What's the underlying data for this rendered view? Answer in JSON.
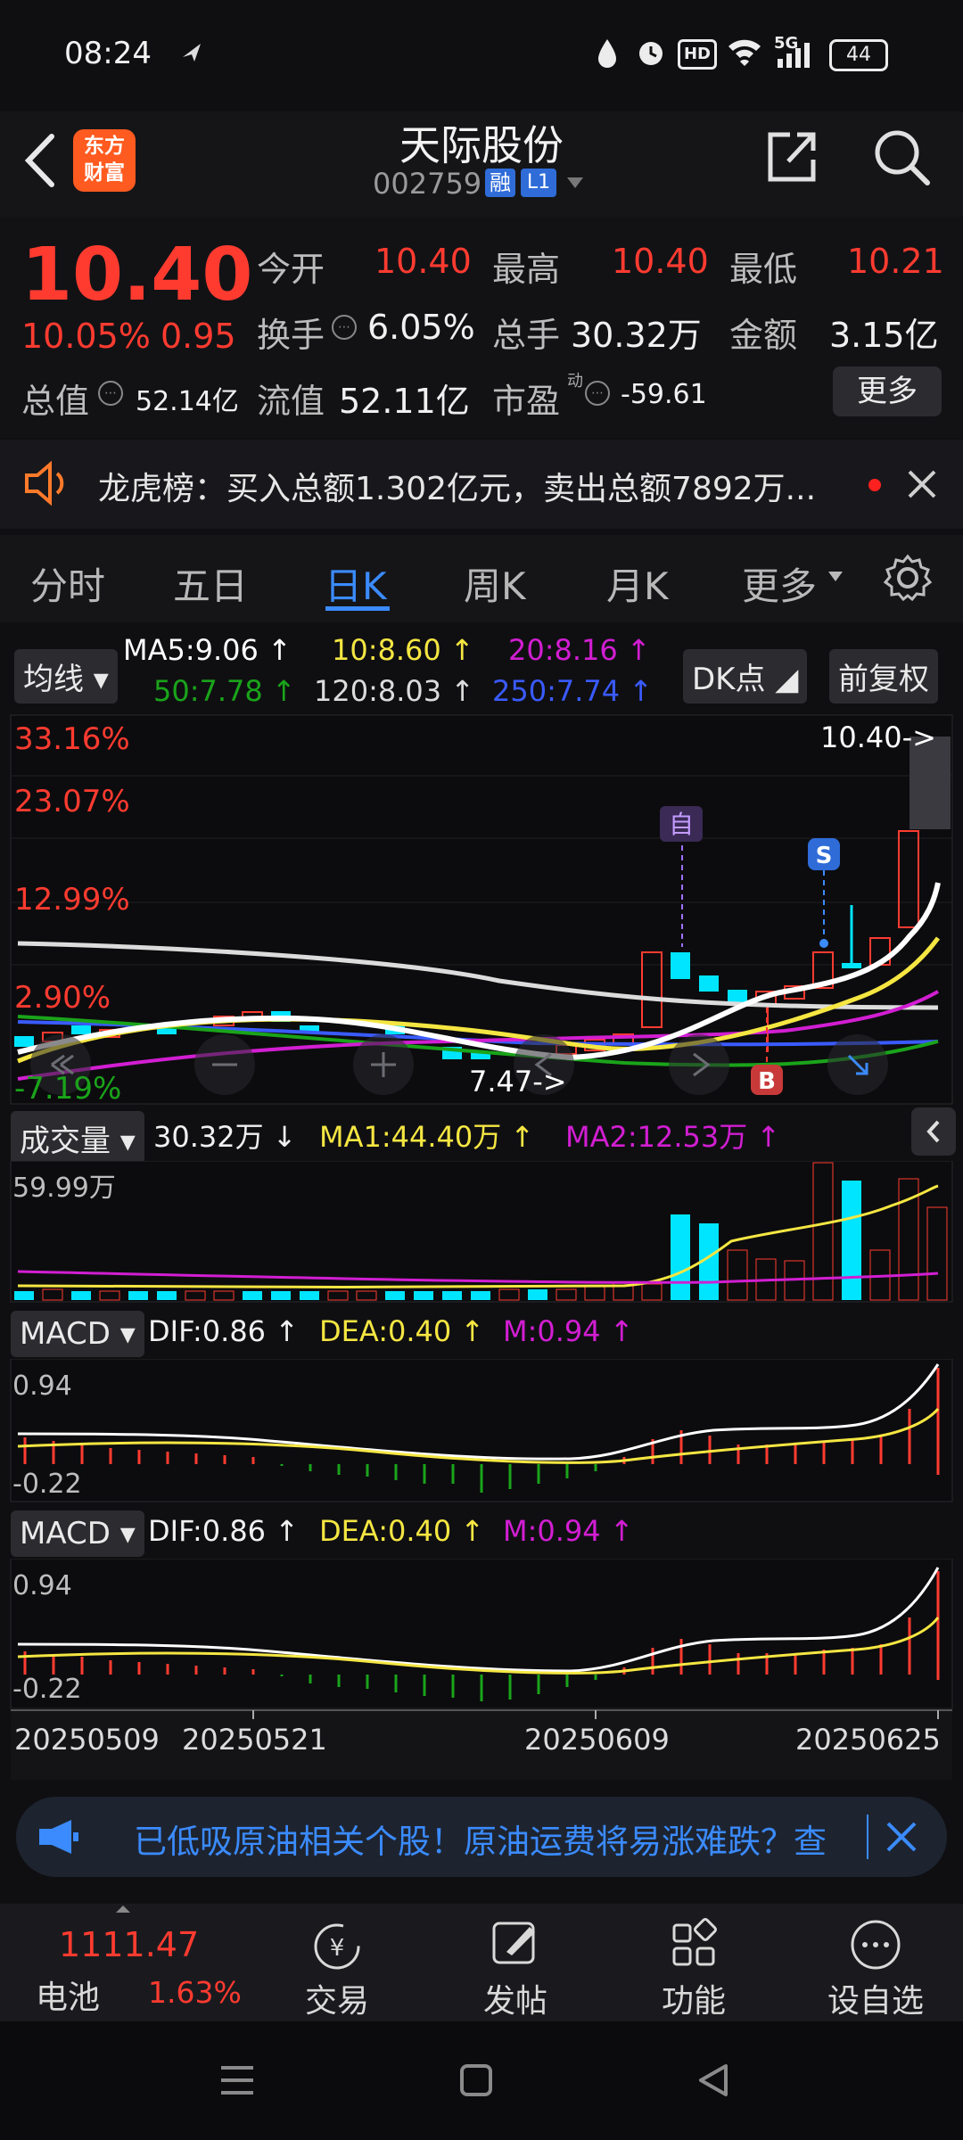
{
  "status": {
    "time": "08:24",
    "battery": "44",
    "network": "5G",
    "hd": "HD"
  },
  "header": {
    "title": "天际股份",
    "code": "002759",
    "badge_rong": "融",
    "badge_l1": "L1",
    "logo_line1": "东方",
    "logo_line2": "财富"
  },
  "quote": {
    "price": "10.40",
    "pct": "10.05%",
    "chg": "0.95",
    "fields": [
      {
        "label": "今开",
        "value": "10.40"
      },
      {
        "label": "最高",
        "value": "10.40"
      },
      {
        "label": "最低",
        "value": "10.21"
      },
      {
        "label": "换手",
        "value": "6.05%"
      },
      {
        "label": "总手",
        "value": "30.32万"
      },
      {
        "label": "金额",
        "value": "3.15亿"
      },
      {
        "label": "总值",
        "value": "52.14亿"
      },
      {
        "label": "流值",
        "value": "52.11亿"
      },
      {
        "label": "市盈",
        "value": "-59.61"
      }
    ],
    "pe_tag": "动",
    "more": "更多"
  },
  "lhb": {
    "text": "龙虎榜：买入总额1.302亿元，卖出总额7892万..."
  },
  "tabs": [
    {
      "label": "分时"
    },
    {
      "label": "五日"
    },
    {
      "label": "日K"
    },
    {
      "label": "周K"
    },
    {
      "label": "月K"
    },
    {
      "label": "更多"
    }
  ],
  "ma": {
    "selector": "均线",
    "ma5": "MA5:9.06 ↑",
    "ma10": "10:8.60 ↑",
    "ma20": "20:8.16 ↑",
    "ma50": "50:7.78 ↑",
    "ma120": "120:8.03 ↑",
    "ma250": "250:7.74 ↑",
    "dk": "DK点",
    "fq": "前复权"
  },
  "kline": {
    "pct_labels": [
      "33.16%",
      "23.07%",
      "12.99%",
      "2.90%",
      "-7.19%"
    ],
    "last_price": "10.40->",
    "low_marker": "7.47->",
    "marker_zi": "自",
    "marker_s": "S",
    "marker_b": "B",
    "colors": {
      "up": "#ff3b30",
      "down": "#00e5ff",
      "ma5": "#ffffff",
      "ma10": "#f5e642",
      "ma20": "#d21ed2",
      "ma50": "#1aa41a",
      "ma120": "#dcdcdc",
      "ma250": "#3a5bff"
    }
  },
  "volume": {
    "selector": "成交量",
    "value": "30.32万 ↓",
    "ma1": "MA1:44.40万 ↑",
    "ma2": "MA2:12.53万 ↑",
    "max": "59.99万"
  },
  "macd1": {
    "selector": "MACD",
    "dif": "DIF:0.86 ↑",
    "dea": "DEA:0.40 ↑",
    "m": "M:0.94 ↑",
    "top": "0.94",
    "bottom": "-0.22"
  },
  "macd2": {
    "selector": "MACD",
    "dif": "DIF:0.86 ↑",
    "dea": "DEA:0.40 ↑",
    "m": "M:0.94 ↑",
    "top": "0.94",
    "bottom": "-0.22"
  },
  "dates": [
    "20250509",
    "20250521",
    "20250609",
    "20250625"
  ],
  "banner": {
    "text": "已低吸原油相关个股！原油运费将易涨难跌？查"
  },
  "bottom": {
    "battery_label": "电池",
    "battery_value": "1111.47",
    "battery_pct": "1.63%",
    "items": [
      {
        "label": "交易"
      },
      {
        "label": "发帖"
      },
      {
        "label": "功能"
      },
      {
        "label": "设自选"
      }
    ]
  }
}
